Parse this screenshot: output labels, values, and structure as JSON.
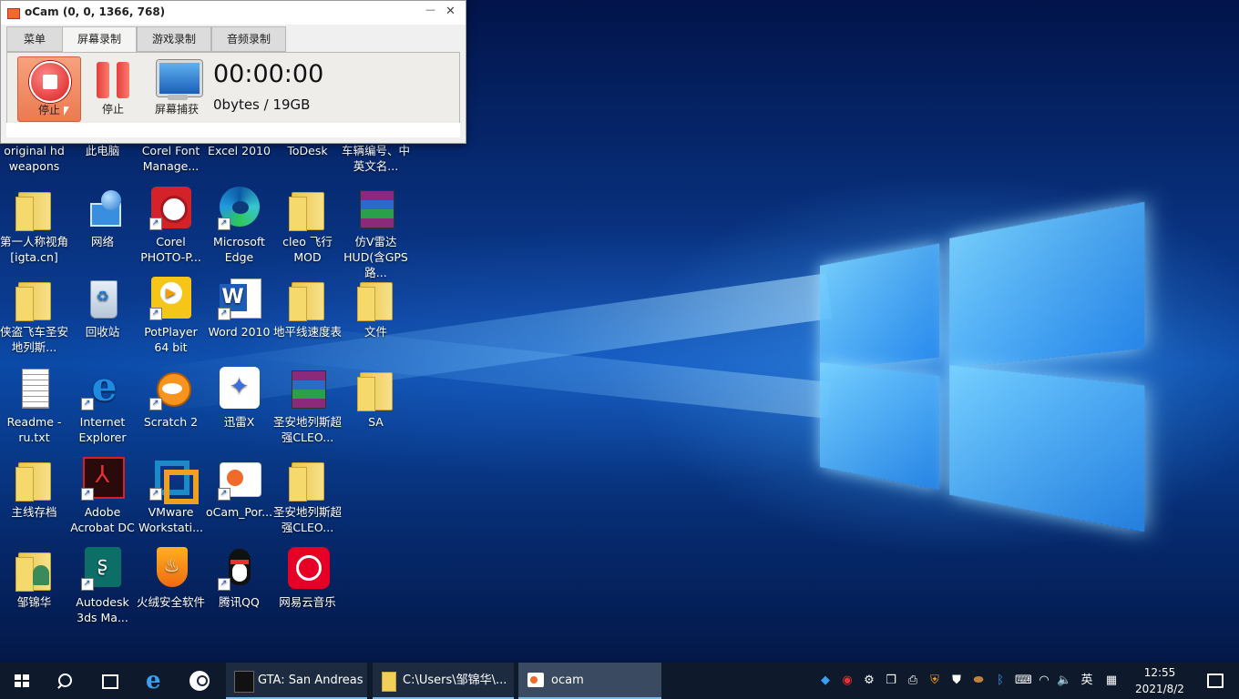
{
  "ocam": {
    "title": "oCam (0, 0, 1366, 768)",
    "close_glyph": "✕",
    "minimize_glyph": "—",
    "tabs": [
      {
        "label": "菜单"
      },
      {
        "label": "屏幕录制"
      },
      {
        "label": "游戏录制"
      },
      {
        "label": "音频录制"
      }
    ],
    "buttons": {
      "stop_record": "停止",
      "pause": "停止",
      "screen_capture": "屏幕捕获"
    },
    "timer": "00:00:00",
    "size": "0bytes / 19GB"
  },
  "desktop_icons": [
    {
      "label": "original hd weapons"
    },
    {
      "label": "此电脑"
    },
    {
      "label": "Corel Font Manage..."
    },
    {
      "label": "Excel 2010"
    },
    {
      "label": "ToDesk"
    },
    {
      "label": "车辆编号、中英文名..."
    },
    {
      "label": "第一人称视角[igta.cn]"
    },
    {
      "label": "网络"
    },
    {
      "label": "Corel PHOTO-P..."
    },
    {
      "label": "Microsoft Edge"
    },
    {
      "label": "cleo 飞行MOD"
    },
    {
      "label": "仿V雷达HUD(含GPS路..."
    },
    {
      "label": "侠盗飞车圣安地列斯..."
    },
    {
      "label": "回收站"
    },
    {
      "label": "PotPlayer 64 bit"
    },
    {
      "label": "Word 2010"
    },
    {
      "label": "地平线速度表"
    },
    {
      "label": "文件"
    },
    {
      "label": "Readme - ru.txt"
    },
    {
      "label": "Internet Explorer"
    },
    {
      "label": "Scratch 2"
    },
    {
      "label": "迅雷X"
    },
    {
      "label": "圣安地列斯超强CLEO..."
    },
    {
      "label": "SA"
    },
    {
      "label": "主线存档"
    },
    {
      "label": "Adobe Acrobat DC"
    },
    {
      "label": "VMware Workstati..."
    },
    {
      "label": "oCam_Por..."
    },
    {
      "label": "圣安地列斯超强CLEO..."
    },
    {
      "label": "邹锦华"
    },
    {
      "label": "Autodesk 3ds Ma..."
    },
    {
      "label": "火绒安全软件"
    },
    {
      "label": "腾讯QQ"
    },
    {
      "label": "网易云音乐"
    }
  ],
  "taskbar": {
    "apps": [
      {
        "label": "GTA: San Andreas"
      },
      {
        "label": "C:\\Users\\邹锦华\\..."
      },
      {
        "label": "ocam"
      }
    ],
    "ime": "英",
    "time": "12:55",
    "date": "2021/8/2"
  },
  "colors": {
    "taskbar_bg": "#0e1a2b",
    "accent": "#76b9ed",
    "record_red": "#e04040"
  }
}
